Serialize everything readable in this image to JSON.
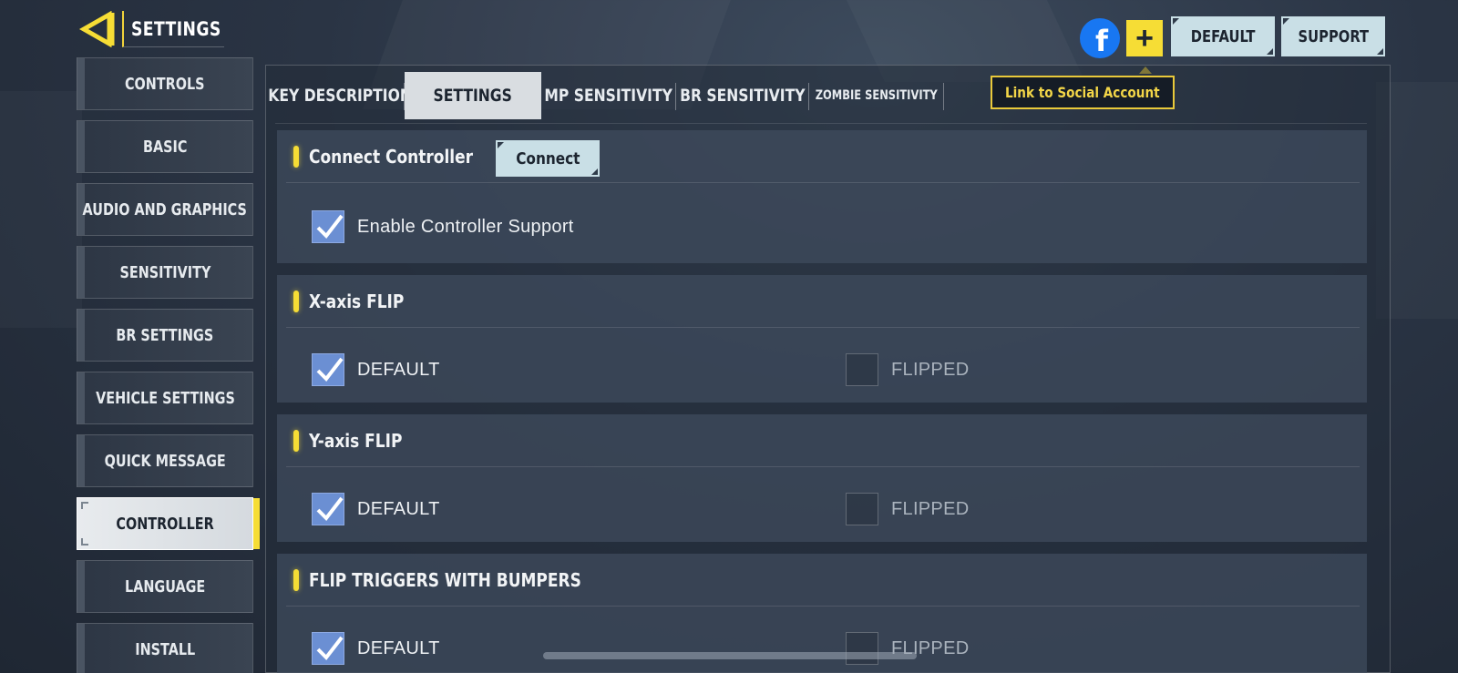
{
  "header": {
    "title": "SETTINGS",
    "facebook_glyph": "f",
    "plus_glyph": "+",
    "default_label": "DEFAULT",
    "support_label": "SUPPORT",
    "tooltip": "Link to Social Account"
  },
  "sidebar": {
    "items": [
      {
        "label": "CONTROLS"
      },
      {
        "label": "BASIC"
      },
      {
        "label": "AUDIO AND GRAPHICS"
      },
      {
        "label": "SENSITIVITY"
      },
      {
        "label": "BR SETTINGS"
      },
      {
        "label": "VEHICLE SETTINGS"
      },
      {
        "label": "QUICK MESSAGE"
      },
      {
        "label": "CONTROLLER"
      },
      {
        "label": "LANGUAGE"
      },
      {
        "label": "INSTALL"
      }
    ],
    "active": "CONTROLLER"
  },
  "tabs": [
    {
      "label": "KEY DESCRIPTION"
    },
    {
      "label": "SETTINGS"
    },
    {
      "label": "MP SENSITIVITY"
    },
    {
      "label": "BR SENSITIVITY"
    },
    {
      "label": "ZOMBIE SENSITIVITY"
    }
  ],
  "active_tab": "SETTINGS",
  "sections": [
    {
      "title": "Connect Controller",
      "button_label": "Connect",
      "options": [
        {
          "label": "Enable Controller Support",
          "checked": true
        }
      ]
    },
    {
      "title": "X-axis FLIP",
      "options": [
        {
          "label": "DEFAULT",
          "checked": true
        },
        {
          "label": "FLIPPED",
          "checked": false
        }
      ]
    },
    {
      "title": "Y-axis FLIP",
      "options": [
        {
          "label": "DEFAULT",
          "checked": true
        },
        {
          "label": "FLIPPED",
          "checked": false
        }
      ]
    },
    {
      "title": "FLIP TRIGGERS WITH BUMPERS",
      "options": [
        {
          "label": "DEFAULT",
          "checked": true
        },
        {
          "label": "FLIPPED",
          "checked": false
        }
      ]
    }
  ],
  "colors": {
    "accent_yellow": "#f6dd35",
    "checkbox_blue": "#6b8fd3",
    "button_light": "#c9dfe6",
    "facebook_blue": "#1877f2"
  },
  "icons": {
    "back": "back-arrow-icon",
    "facebook": "facebook-icon",
    "plus": "plus-icon",
    "check": "checkmark-icon"
  }
}
